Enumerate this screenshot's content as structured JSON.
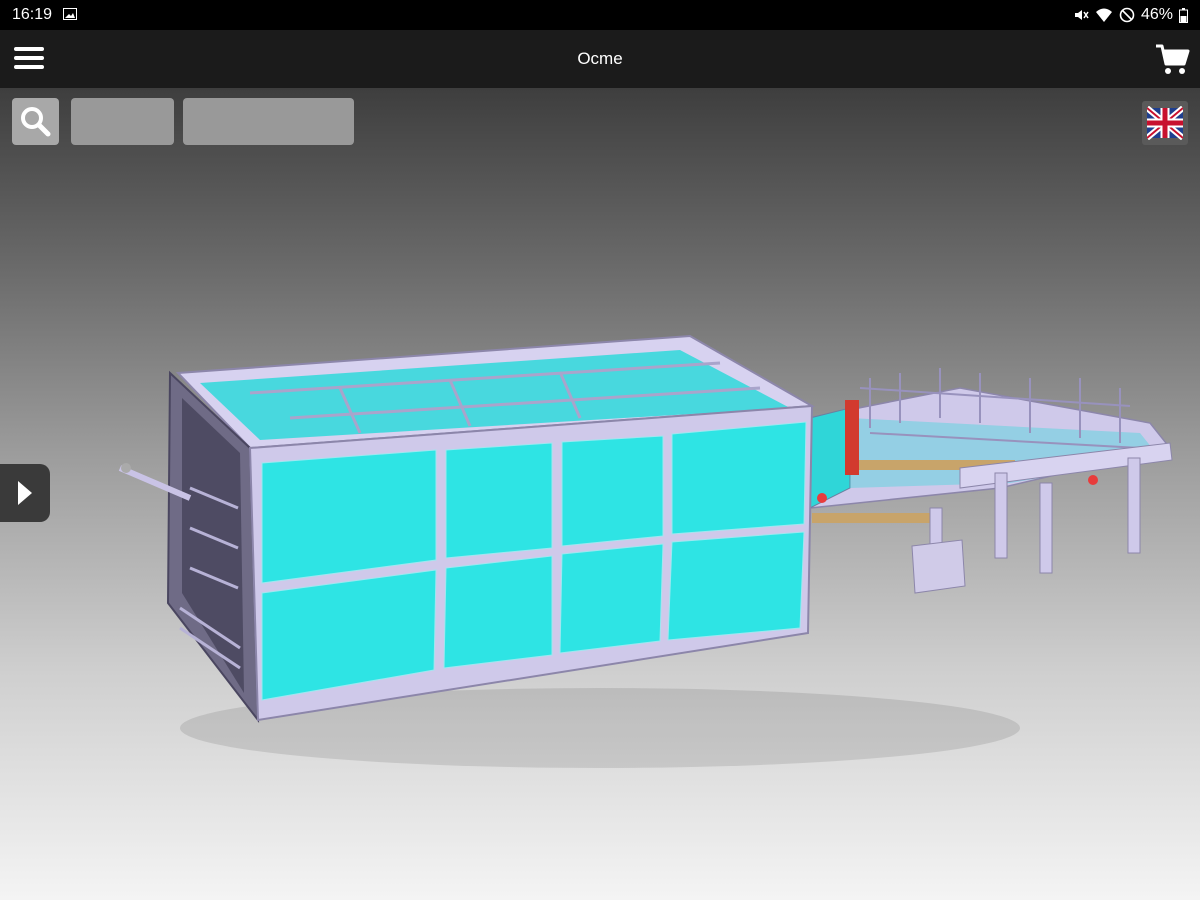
{
  "status_bar": {
    "time": "16:19",
    "battery": "46%",
    "icons": [
      "image-icon",
      "mute-icon",
      "wifi-icon",
      "do-not-disturb-icon",
      "battery-icon"
    ]
  },
  "app_bar": {
    "title": "Ocme",
    "icons": [
      "menu-icon",
      "cart-icon"
    ]
  },
  "toolbar": {
    "search_icon": "search-icon",
    "button_1_label": "",
    "button_2_label": "",
    "language_icon": "uk-flag-icon"
  },
  "side_panel": {
    "toggle_icon": "chevron-right-icon"
  },
  "model": {
    "description_visible": false,
    "panel_color": "#2ee4e4",
    "frame_color": "#c9c3e6"
  },
  "colors": {
    "status_bar": "#000000",
    "app_bar": "#1b1b1b",
    "button_gray": "#999999"
  }
}
